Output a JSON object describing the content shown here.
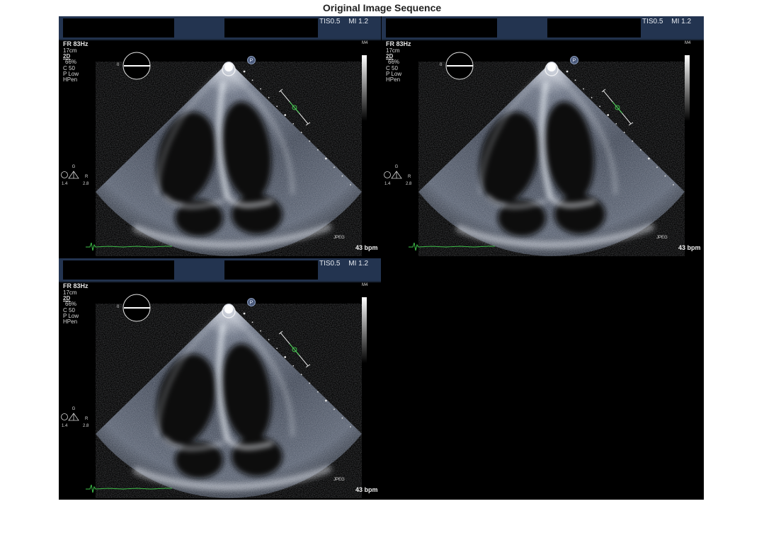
{
  "figure": {
    "title": "Original Image Sequence"
  },
  "frames": [
    {
      "tis": "TIS0.5",
      "mi": "MI 1.2",
      "frame_rate": "FR 83Hz",
      "params": [
        "17cm",
        "2D",
        "66%",
        "C 50",
        "P Low",
        "HPen"
      ],
      "marker_m4": "M4",
      "zero_label": "0",
      "gain_scale": {
        "g": "G",
        "left": "1.4",
        "right": "2.8",
        "r": "R"
      },
      "format_label": "JPEG",
      "heart_rate": "43 bpm",
      "probe_marker": "P"
    },
    {
      "tis": "TIS0.5",
      "mi": "MI 1.2",
      "frame_rate": "FR 83Hz",
      "params": [
        "17cm",
        "2D",
        "66%",
        "C 50",
        "P Low",
        "HPen"
      ],
      "marker_m4": "M4",
      "zero_label": "0",
      "gain_scale": {
        "g": "G",
        "left": "1.4",
        "right": "2.8",
        "r": "R"
      },
      "format_label": "JPEG",
      "heart_rate": "43 bpm",
      "probe_marker": "P"
    },
    {
      "tis": "TIS0.5",
      "mi": "MI 1.2",
      "frame_rate": "FR 83Hz",
      "params": [
        "17cm",
        "2D",
        "66%",
        "C 50",
        "P Low",
        "HPen"
      ],
      "marker_m4": "M4",
      "zero_label": "0",
      "gain_scale": {
        "g": "G",
        "left": "1.4",
        "right": "2.8",
        "r": "R"
      },
      "format_label": "JPEG",
      "heart_rate": "43 bpm",
      "probe_marker": "P"
    }
  ],
  "colors": {
    "header_bar": "#233450",
    "ecg_trace": "#3fbf4a",
    "montage_bg": "#000000"
  }
}
